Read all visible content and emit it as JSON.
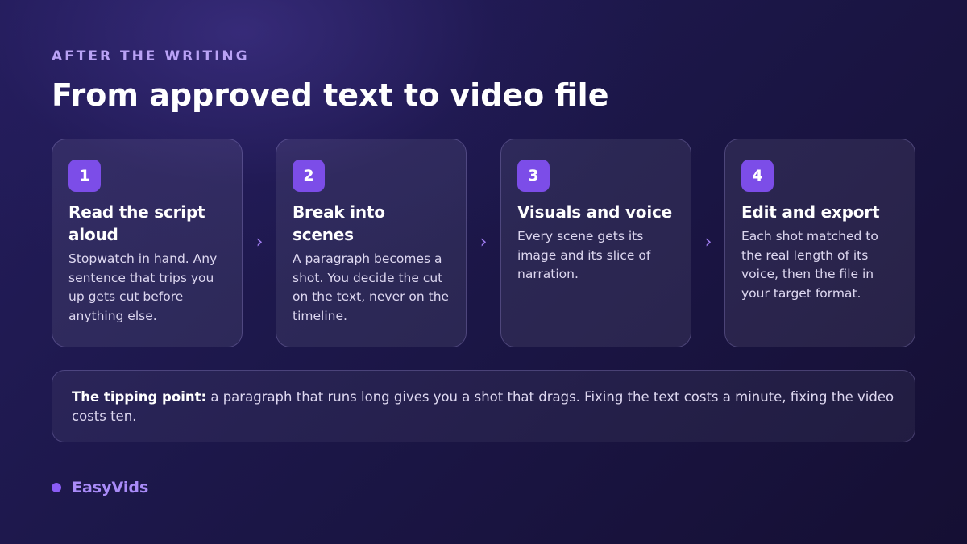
{
  "header": {
    "eyebrow": "AFTER THE WRITING",
    "title": "From approved text to video file"
  },
  "steps": [
    {
      "number": "1",
      "title": "Read the script aloud",
      "body": "Stopwatch in hand. Any sentence that trips you up gets cut before anything else."
    },
    {
      "number": "2",
      "title": "Break into scenes",
      "body": "A paragraph becomes a shot. You decide the cut on the text, never on the timeline."
    },
    {
      "number": "3",
      "title": "Visuals and voice",
      "body": "Every scene gets its image and its slice of narration."
    },
    {
      "number": "4",
      "title": "Edit and export",
      "body": "Each shot matched to the real length of its voice, then the file in your target format."
    }
  ],
  "arrows": {
    "glyph": "›",
    "icon": "chevron-right-icon"
  },
  "note": {
    "lead": "The tipping point:",
    "text": " a paragraph that runs long gives you a shot that drags. Fixing the text costs a minute, fixing the video costs ten."
  },
  "brand": {
    "name": "EasyVids",
    "icon": "dot-icon"
  },
  "colors": {
    "accent": "#7c4de8",
    "eyebrow": "#b9a2f5",
    "brand": "#a98bf8",
    "background_start": "#241d5c",
    "background_end": "#150f33"
  }
}
